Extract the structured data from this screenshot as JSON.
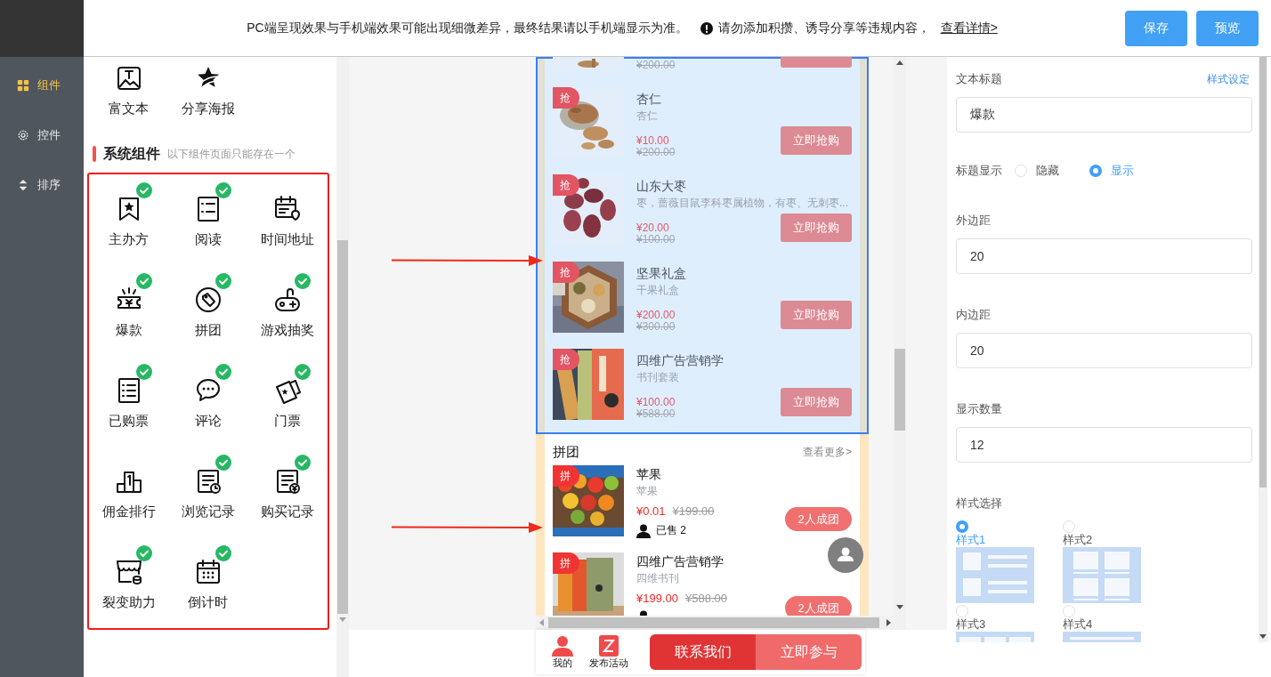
{
  "header": {
    "notice": "PC端呈现效果与手机端效果可能出现细微差异，最终结果请以手机端显示为准。",
    "warning": "请勿添加积攒、诱导分享等违规内容，",
    "details_link": "查看详情>",
    "buttons": [
      {
        "label": "保存"
      },
      {
        "label": "预览"
      }
    ]
  },
  "sidebar": {
    "items": [
      {
        "label": "组件",
        "selected": true
      },
      {
        "label": "控件",
        "selected": false
      },
      {
        "label": "排序",
        "selected": false
      }
    ]
  },
  "component_panel": {
    "basic_items": [
      {
        "label": "富文本"
      },
      {
        "label": "分享海报"
      }
    ],
    "section": {
      "title": "系统组件",
      "hint": "以下组件页面只能存在一个"
    },
    "system_items": [
      {
        "label": "主办方",
        "added": true
      },
      {
        "label": "阅读",
        "added": true
      },
      {
        "label": "时间地址",
        "added": false
      },
      {
        "label": "爆款",
        "added": true
      },
      {
        "label": "拼团",
        "added": true
      },
      {
        "label": "游戏抽奖",
        "added": true
      },
      {
        "label": "已购票",
        "added": true
      },
      {
        "label": "评论",
        "added": true
      },
      {
        "label": "门票",
        "added": true
      },
      {
        "label": "佣金排行",
        "added": false
      },
      {
        "label": "浏览记录",
        "added": true
      },
      {
        "label": "购买记录",
        "added": true
      },
      {
        "label": "裂变助力",
        "added": true
      },
      {
        "label": "倒计时",
        "added": true
      }
    ]
  },
  "preview": {
    "flash_sale": {
      "selected": true,
      "items": [
        {
          "old_price": "¥200.00"
        },
        {
          "tag": "抢",
          "name": "杏仁",
          "subtitle": "杏仁",
          "price": "¥10.00",
          "old_price": "¥200.00",
          "button": "立即抢购"
        },
        {
          "tag": "抢",
          "name": "山东大枣",
          "subtitle": "枣，蔷薇目鼠李科枣属植物，有枣、无刺枣...",
          "price": "¥20.00",
          "old_price": "¥100.00",
          "button": "立即抢购"
        },
        {
          "tag": "抢",
          "name": "坚果礼盒",
          "subtitle": "干果礼盒",
          "price": "¥200.00",
          "old_price": "¥300.00",
          "button": "立即抢购"
        },
        {
          "tag": "抢",
          "name": "四维广告营销学",
          "subtitle": "书刊套装",
          "price": "¥100.00",
          "old_price": "¥588.00",
          "button": "立即抢购"
        }
      ]
    },
    "group_buy": {
      "title": "拼团",
      "more": "查看更多>",
      "items": [
        {
          "tag": "拼",
          "name": "苹果",
          "subtitle": "苹果",
          "price": "¥0.01",
          "old_price": "¥199.00",
          "sold": "已售 2",
          "button": "2人成团"
        },
        {
          "tag": "拼",
          "name": "四维广告营销学",
          "subtitle": "四维书刊",
          "price": "¥199.00",
          "old_price": "¥588.00",
          "button": "2人成团"
        }
      ]
    },
    "bottom_nav": {
      "items": [
        {
          "label": "我的"
        },
        {
          "label": "发布活动"
        }
      ],
      "buttons": [
        {
          "label": "联系我们"
        },
        {
          "label": "立即参与"
        }
      ]
    }
  },
  "settings": {
    "title_label": "文本标题",
    "style_link": "样式设定",
    "title_input": {
      "value": "爆款"
    },
    "title_display": {
      "label": "标题显示",
      "options": [
        {
          "label": "隐藏",
          "selected": false
        },
        {
          "label": "显示",
          "selected": true
        }
      ]
    },
    "fields": [
      {
        "label": "外边距",
        "value": "20"
      },
      {
        "label": "内边距",
        "value": "20"
      },
      {
        "label": "显示数量",
        "value": "12"
      }
    ],
    "style_choice": {
      "label": "样式选择",
      "options": [
        {
          "label": "样式1",
          "selected": true
        },
        {
          "label": "样式2",
          "selected": false
        },
        {
          "label": "样式3",
          "selected": false
        },
        {
          "label": "样式4",
          "selected": false
        }
      ]
    }
  }
}
